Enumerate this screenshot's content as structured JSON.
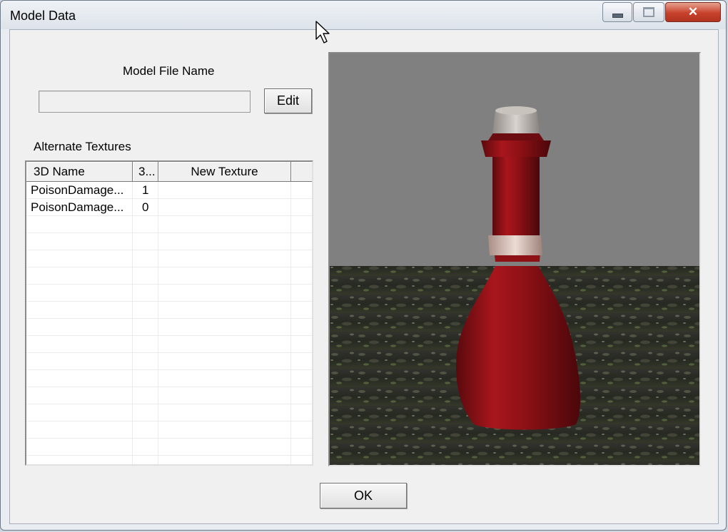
{
  "window": {
    "title": "Model Data"
  },
  "model_file": {
    "label": "Model File Name",
    "value": "",
    "edit_label": "Edit"
  },
  "textures": {
    "label": "Alternate Textures",
    "columns": [
      "3D Name",
      "3...",
      "New Texture"
    ],
    "rows": [
      {
        "name": "PoisonDamage...",
        "index": "1",
        "new_texture": ""
      },
      {
        "name": "PoisonDamage...",
        "index": "0",
        "new_texture": ""
      }
    ]
  },
  "preview": {
    "subject": "red potion bottle with cork",
    "background_color": "#808080",
    "bottle_color": "#8c0f14"
  },
  "footer": {
    "ok_label": "OK"
  }
}
